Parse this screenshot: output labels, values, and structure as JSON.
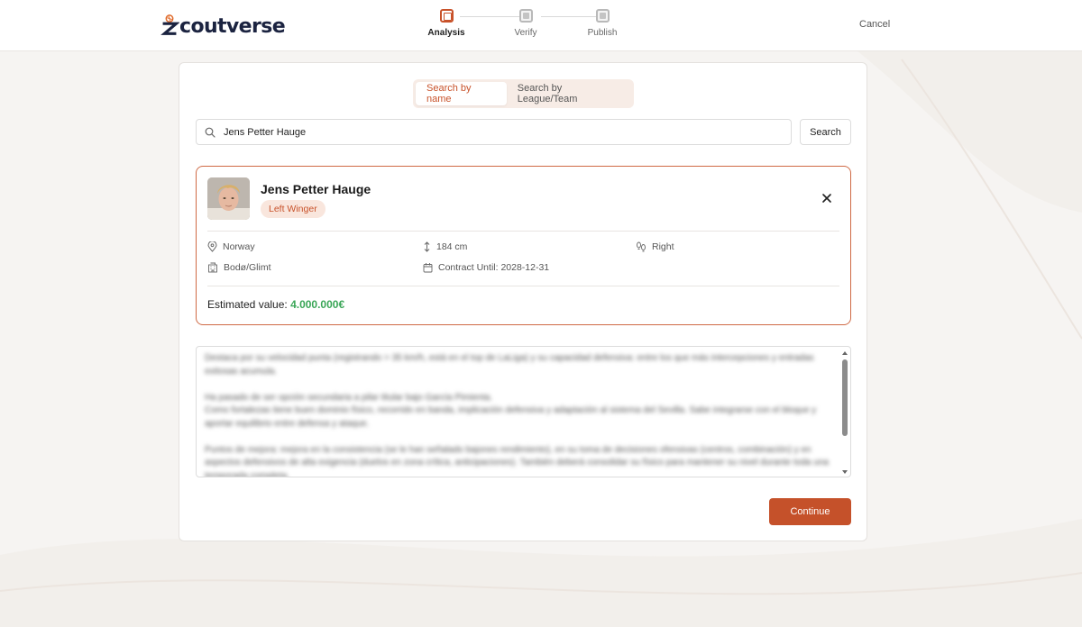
{
  "brand": {
    "name": "coutverse",
    "accent": "#c5512a",
    "value_color": "#3aa657"
  },
  "stepper": {
    "steps": [
      {
        "label": "Analysis",
        "state": "active"
      },
      {
        "label": "Verify",
        "state": "pending"
      },
      {
        "label": "Publish",
        "state": "pending"
      }
    ]
  },
  "header": {
    "cancel_label": "Cancel"
  },
  "search": {
    "tabs": [
      {
        "label": "Search by name",
        "active": true
      },
      {
        "label": "Search by League/Team",
        "active": false
      }
    ],
    "value": "Jens Petter Hauge",
    "button_label": "Search"
  },
  "player": {
    "name": "Jens Petter Hauge",
    "position": "Left Winger",
    "country": "Norway",
    "height": "184 cm",
    "foot": "Right",
    "club": "Bodø/Glimt",
    "contract": "Contract Until: 2028-12-31",
    "estimated_label": "Estimated value:",
    "estimated_value": "4.000.000€"
  },
  "notes": {
    "text": "Destaca por su velocidad punta (registrando > 35 km/h, está en el top de LaLiga) y su capacidad defensiva: entre los que más intercepciones y entradas exitosas acumula.\n\nHa pasado de ser opción secundaria a pilar titular bajo García Pimienta.\nComo fortalezas tiene buen dominio físico, recorrido en banda, implicación defensiva y adaptación al sistema del Sevilla. Sabe integrarse con el bloque y aportar equilibrio entre defensa y ataque.\n\nPuntos de mejora: mejora en la consistencia (se le han señalado bajones rendimiento), en su toma de decisiones ofensivas (centros, combinación) y en aspectos defensivos de alta exigencia (duelos en zona crítica, anticipaciones). También deberá consolidar su físico para mantener su nivel durante toda una temporada completa."
  },
  "actions": {
    "continue_label": "Continue"
  }
}
